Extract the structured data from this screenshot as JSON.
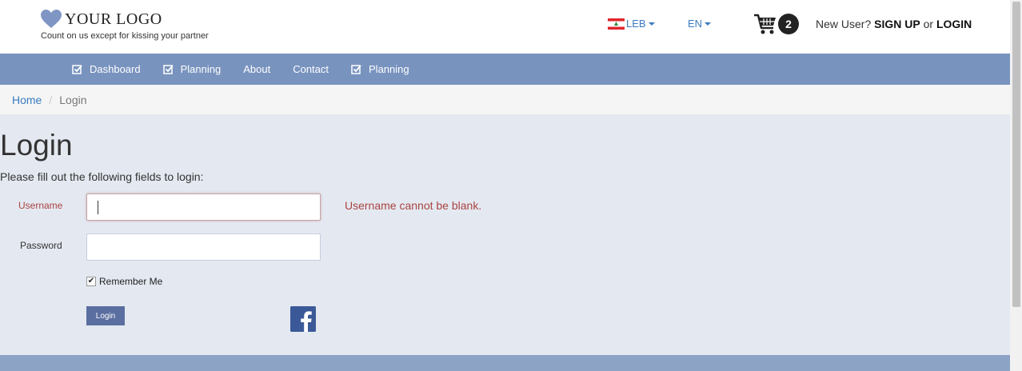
{
  "header": {
    "logo_text": "YOUR LOGO",
    "tagline": "Count on us except for kissing your partner",
    "language_country": "LEB",
    "language": "EN",
    "cart_count": "2",
    "new_user_text": "New User?",
    "signup_label": "SIGN UP",
    "or_text": "or",
    "login_label": "LOGIN"
  },
  "nav": {
    "items": [
      {
        "label": "Dashboard",
        "icon": "check-square-icon"
      },
      {
        "label": "Planning",
        "icon": "check-square-icon"
      },
      {
        "label": "About",
        "icon": ""
      },
      {
        "label": "Contact",
        "icon": ""
      },
      {
        "label": "Planning",
        "icon": "check-square-icon"
      }
    ]
  },
  "breadcrumb": {
    "home": "Home",
    "separator": "/",
    "current": "Login"
  },
  "form": {
    "title": "Login",
    "subtitle": "Please fill out the following fields to login:",
    "username_label": "Username",
    "username_value": "",
    "username_error": "Username cannot be blank.",
    "password_label": "Password",
    "password_value": "",
    "remember_label": "Remember Me",
    "remember_checked": true,
    "submit_label": "Login"
  },
  "colors": {
    "navbar": "#7893be",
    "main_bg": "#e4e9f1",
    "error": "#a94442",
    "link": "#3a7bbf",
    "button": "#5a6ea0",
    "facebook": "#3b5998"
  }
}
